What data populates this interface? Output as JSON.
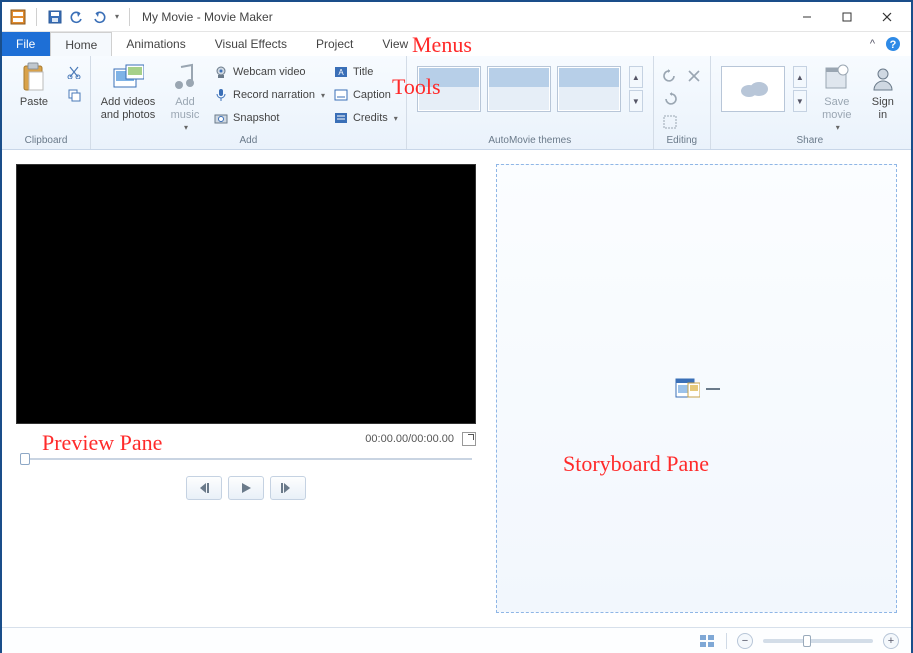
{
  "window": {
    "title": "My Movie - Movie Maker"
  },
  "menus": {
    "file": "File",
    "tabs": [
      "Home",
      "Animations",
      "Visual Effects",
      "Project",
      "View"
    ],
    "active": "Home"
  },
  "ribbon": {
    "clipboard": {
      "label": "Clipboard",
      "paste": "Paste"
    },
    "add": {
      "label": "Add",
      "add_videos": "Add videos\nand photos",
      "add_music": "Add\nmusic",
      "webcam": "Webcam video",
      "record": "Record narration",
      "snapshot": "Snapshot",
      "title": "Title",
      "caption": "Caption",
      "credits": "Credits"
    },
    "automovie": {
      "label": "AutoMovie themes"
    },
    "editing": {
      "label": "Editing"
    },
    "share": {
      "label": "Share",
      "save_movie": "Save\nmovie",
      "sign_in": "Sign\nin"
    }
  },
  "preview": {
    "time": "00:00.00/00:00.00"
  },
  "annotations": {
    "menus": "Menus",
    "tools": "Tools",
    "preview": "Preview Pane",
    "storyboard": "Storyboard Pane"
  }
}
